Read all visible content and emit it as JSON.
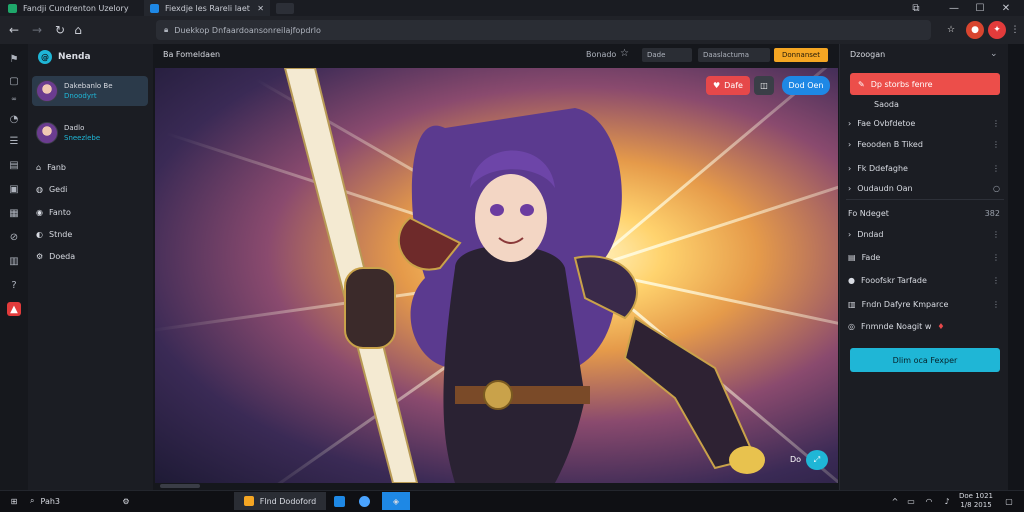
{
  "browser": {
    "tabs": [
      {
        "label": "Fandji Cundrenton Uzelory"
      },
      {
        "label": "Fiexdje les Rareli laet"
      }
    ],
    "window_controls": [
      "—",
      "☐",
      "✕"
    ],
    "url": "Duekkop Dnfaardoansonreilajfopdrlo"
  },
  "sidebar": {
    "header": "Nenda",
    "profiles": [
      {
        "name": "Dakebanlo Be",
        "sub": "Dnoodyrt",
        "selected": true
      },
      {
        "name": "Dadlo",
        "sub": "Sneezlebe",
        "selected": false
      }
    ],
    "items": [
      {
        "label": "Fanb",
        "icon": "home-icon"
      },
      {
        "label": "Gedi",
        "icon": "globe-icon"
      },
      {
        "label": "Fanto",
        "icon": "chat-icon"
      },
      {
        "label": "Stnde",
        "icon": "bookmark-icon"
      },
      {
        "label": "Doeda",
        "icon": "settings-icon"
      }
    ]
  },
  "main": {
    "title": "Ba Fomeldaen",
    "toolbar": {
      "label": "Bonado",
      "field1": "Dade",
      "field2": "Daaslactuma",
      "primary_button": "Donnanset"
    },
    "chips": {
      "red": "Dafe",
      "blue": "Dod Oen"
    },
    "corner_label": "Do"
  },
  "right_panel": {
    "header": "Dzoogan",
    "primary_button": "Dp storbs fenre",
    "section_label": "Saoda",
    "group1": [
      {
        "label": "Fae Ovbfdetoe",
        "more": "⋮"
      },
      {
        "label": "Feooden B Tiked",
        "more": "⋮"
      },
      {
        "label": "Fk Ddefaghe",
        "more": "⋮"
      },
      {
        "label": "Oudaudn Oan",
        "more": "○"
      }
    ],
    "section2": {
      "label": "Fo Ndeget",
      "count": "382"
    },
    "group2": [
      {
        "label": "Dndad",
        "more": "⋮"
      },
      {
        "label": "Fade",
        "more": "⋮"
      },
      {
        "label": "Fooofskr Tarfade",
        "more": "⋮"
      },
      {
        "label": "Fndn Dafyre Kmparce",
        "more": "⋮"
      },
      {
        "label": "Fnmnde Noagit w",
        "more": ""
      }
    ],
    "bottom_button": "Dlim oca Fexper"
  },
  "taskbar": {
    "search": "Pah3",
    "app_label": "Flnd Dodoford",
    "clock_time": "Doe 1021",
    "clock_date": "1/8 2015"
  },
  "colors": {
    "accent_orange": "#f5a623",
    "accent_red": "#ec4e4a",
    "accent_cyan": "#1fb6d6",
    "accent_blue": "#1e88e5"
  }
}
